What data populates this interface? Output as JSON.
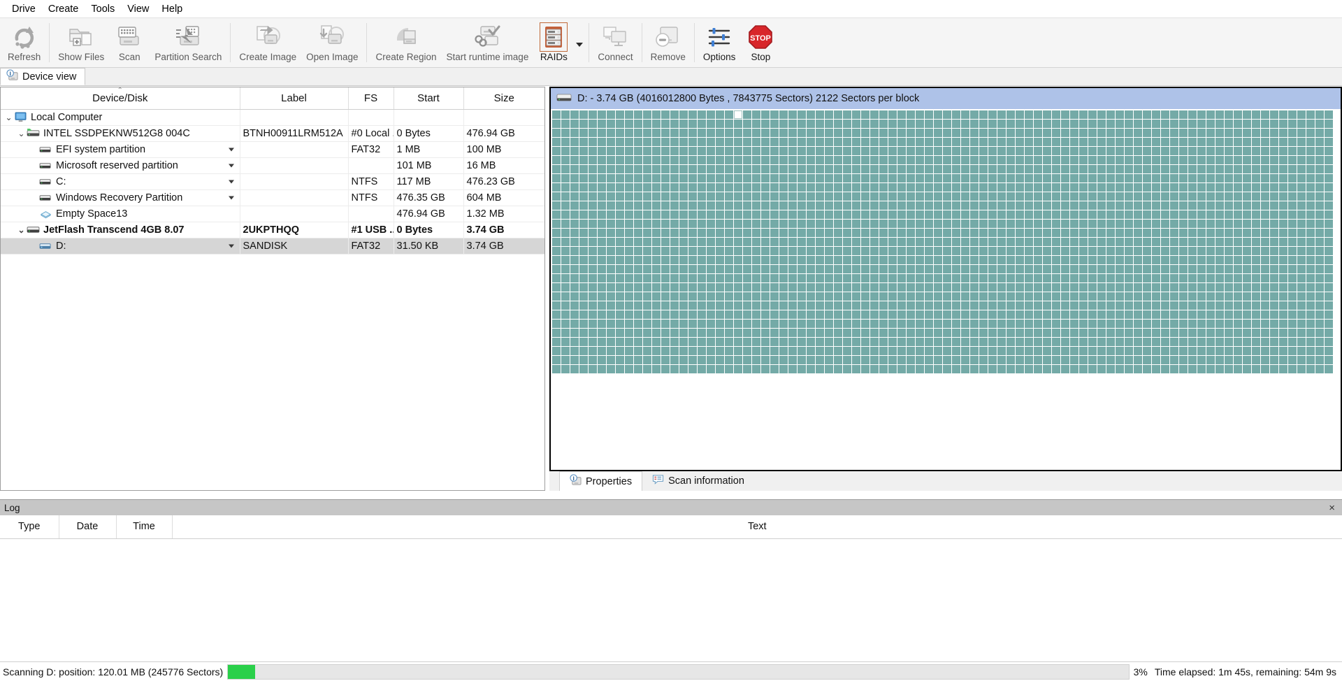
{
  "menubar": {
    "items": [
      "Drive",
      "Create",
      "Tools",
      "View",
      "Help"
    ]
  },
  "toolbar": {
    "buttons": [
      {
        "label": "Refresh",
        "icon": "refresh-icon",
        "enabled": false
      },
      {
        "label": "Show Files",
        "icon": "show-files-icon",
        "enabled": false
      },
      {
        "label": "Scan",
        "icon": "scan-icon",
        "enabled": false
      },
      {
        "label": "Partition Search",
        "icon": "partition-search-icon",
        "enabled": false
      },
      {
        "label": "Create Image",
        "icon": "create-image-icon",
        "enabled": false
      },
      {
        "label": "Open Image",
        "icon": "open-image-icon",
        "enabled": false
      },
      {
        "label": "Create Region",
        "icon": "create-region-icon",
        "enabled": false
      },
      {
        "label": "Start runtime image",
        "icon": "start-runtime-image-icon",
        "enabled": false
      },
      {
        "label": "RAIDs",
        "icon": "raids-icon",
        "enabled": true
      },
      {
        "label": "Connect",
        "icon": "connect-icon",
        "enabled": false
      },
      {
        "label": "Remove",
        "icon": "remove-icon",
        "enabled": false
      },
      {
        "label": "Options",
        "icon": "options-sliders-icon",
        "enabled": true
      },
      {
        "label": "Stop",
        "icon": "stop-icon",
        "enabled": true
      }
    ]
  },
  "device_view_tab": {
    "label": "Device view",
    "icon": "device-info-icon"
  },
  "tree": {
    "columns": [
      "Device/Disk",
      "Label",
      "FS",
      "Start",
      "Size"
    ],
    "sort_column": "Device/Disk",
    "sort_indicator": "⌃",
    "rows": [
      {
        "indent": 0,
        "expander": "⌄",
        "icon": "computer-icon",
        "name": "Local Computer",
        "label": "",
        "fs": "",
        "start": "",
        "size": "",
        "caret": false,
        "bold": false,
        "selected": false
      },
      {
        "indent": 1,
        "expander": "⌄",
        "icon": "disk-icon-green",
        "name": "INTEL SSDPEKNW512G8 004C",
        "label": "BTNH00911LRM512A",
        "fs": "#0 Local ...",
        "start": "0 Bytes",
        "size": "476.94 GB",
        "caret": false,
        "bold": false,
        "selected": false
      },
      {
        "indent": 2,
        "expander": "",
        "icon": "partition-icon",
        "name": "EFI system partition",
        "label": "",
        "fs": "FAT32",
        "start": "1 MB",
        "size": "100 MB",
        "caret": true,
        "bold": false,
        "selected": false
      },
      {
        "indent": 2,
        "expander": "",
        "icon": "partition-icon",
        "name": "Microsoft reserved partition",
        "label": "",
        "fs": "",
        "start": "101 MB",
        "size": "16 MB",
        "caret": true,
        "bold": false,
        "selected": false
      },
      {
        "indent": 2,
        "expander": "",
        "icon": "partition-icon",
        "name": "C:",
        "label": "",
        "fs": "NTFS",
        "start": "117 MB",
        "size": "476.23 GB",
        "caret": true,
        "bold": false,
        "selected": false
      },
      {
        "indent": 2,
        "expander": "",
        "icon": "partition-icon",
        "name": "Windows Recovery Partition",
        "label": "",
        "fs": "NTFS",
        "start": "476.35 GB",
        "size": "604 MB",
        "caret": true,
        "bold": false,
        "selected": false
      },
      {
        "indent": 2,
        "expander": "",
        "icon": "empty-space-icon",
        "name": "Empty Space13",
        "label": "",
        "fs": "",
        "start": "476.94 GB",
        "size": "1.32 MB",
        "caret": false,
        "bold": false,
        "selected": false
      },
      {
        "indent": 1,
        "expander": "⌄",
        "icon": "usb-disk-icon",
        "name": "JetFlash Transcend 4GB 8.07",
        "label": "2UKPTHQQ",
        "fs": "#1 USB ...",
        "start": "0 Bytes",
        "size": "3.74 GB",
        "caret": false,
        "bold": true,
        "selected": false
      },
      {
        "indent": 2,
        "expander": "",
        "icon": "partition-icon-blue",
        "name": "D:",
        "label": "SANDISK",
        "fs": "FAT32",
        "start": "31.50 KB",
        "size": "3.74 GB",
        "caret": true,
        "bold": false,
        "selected": true
      }
    ]
  },
  "diskmap": {
    "header_icon": "disk-icon",
    "title": "D: - 3.74 GB (4016012800 Bytes , 7843775 Sectors) 2122 Sectors per block",
    "block_color": "#74aaa7",
    "header_color": "#aec2e8",
    "tabs": [
      {
        "label": "Properties",
        "icon": "properties-info-icon",
        "active": true
      },
      {
        "label": "Scan information",
        "icon": "scan-information-icon",
        "active": false
      }
    ]
  },
  "log": {
    "title": "Log",
    "close_label": "×",
    "columns": [
      "Type",
      "Date",
      "Time",
      "Text"
    ],
    "rows": []
  },
  "statusbar": {
    "text": "Scanning D: position: 120.01 MB (245776 Sectors)",
    "progress_percent": "3%",
    "progress_value": 3,
    "progress_color": "#2ad04a",
    "elapsed": "Time elapsed: 1m 45s, remaining: 54m 9s"
  }
}
